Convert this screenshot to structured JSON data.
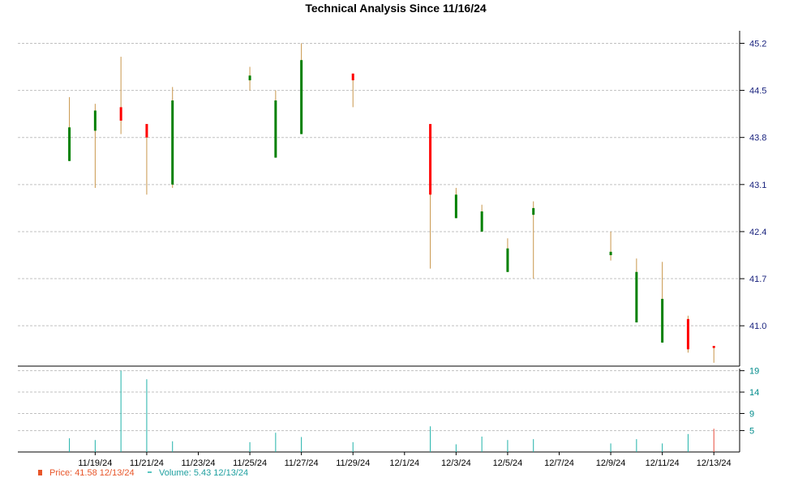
{
  "chart_data": {
    "type": "candlestick",
    "title": "Technical Analysis Since 11/16/24",
    "price_axis": {
      "ylim": [
        40.4,
        45.35
      ],
      "ticks": [
        "45.2",
        "44.5",
        "43.8",
        "43.1",
        "42.4",
        "41.7",
        "41.0"
      ]
    },
    "volume_axis": {
      "ylim": [
        0,
        19.5
      ],
      "ticks": [
        "19",
        "14",
        "9",
        "5"
      ]
    },
    "x_ticks": [
      "11/19/24",
      "11/21/24",
      "11/23/24",
      "11/25/24",
      "11/27/24",
      "11/29/24",
      "12/1/24",
      "12/3/24",
      "12/5/24",
      "12/7/24",
      "12/9/24",
      "12/11/24",
      "12/13/24"
    ],
    "grid": true,
    "colors": {
      "up": "#008000",
      "down": "#ff0000",
      "wick": "#c8964b",
      "volume": "#20b2aa",
      "last_volume": "#e74c3c",
      "price_axis": "#1a237e",
      "volume_axis": "#008b8b"
    },
    "candles": [
      {
        "date": "11/18/24",
        "open": 43.45,
        "high": 44.4,
        "low": 43.45,
        "close": 43.95,
        "volume": 3.2
      },
      {
        "date": "11/19/24",
        "open": 43.9,
        "high": 44.3,
        "low": 43.05,
        "close": 44.2,
        "volume": 2.8
      },
      {
        "date": "11/20/24",
        "open": 44.25,
        "high": 45.0,
        "low": 43.85,
        "close": 44.05,
        "volume": 19.0
      },
      {
        "date": "11/21/24",
        "open": 44.0,
        "high": 44.0,
        "low": 42.95,
        "close": 43.8,
        "volume": 17.0
      },
      {
        "date": "11/22/24",
        "open": 43.1,
        "high": 44.55,
        "low": 43.05,
        "close": 44.35,
        "volume": 2.5
      },
      {
        "date": "11/25/24",
        "open": 44.65,
        "high": 44.85,
        "low": 44.5,
        "close": 44.72,
        "volume": 2.3
      },
      {
        "date": "11/26/24",
        "open": 43.5,
        "high": 44.5,
        "low": 43.5,
        "close": 44.35,
        "volume": 4.5
      },
      {
        "date": "11/27/24",
        "open": 43.85,
        "high": 45.2,
        "low": 43.85,
        "close": 44.95,
        "volume": 3.5
      },
      {
        "date": "11/29/24",
        "open": 44.75,
        "high": 44.75,
        "low": 44.25,
        "close": 44.65,
        "volume": 2.3
      },
      {
        "date": "12/2/24",
        "open": 44.0,
        "high": 44.0,
        "low": 41.85,
        "close": 42.95,
        "volume": 6.0
      },
      {
        "date": "12/3/24",
        "open": 42.6,
        "high": 43.05,
        "low": 42.6,
        "close": 42.95,
        "volume": 1.8
      },
      {
        "date": "12/4/24",
        "open": 42.4,
        "high": 42.8,
        "low": 42.4,
        "close": 42.7,
        "volume": 3.6
      },
      {
        "date": "12/5/24",
        "open": 41.8,
        "high": 42.3,
        "low": 41.8,
        "close": 42.15,
        "volume": 2.8
      },
      {
        "date": "12/6/24",
        "open": 42.65,
        "high": 42.85,
        "low": 41.7,
        "close": 42.75,
        "volume": 3.0
      },
      {
        "date": "12/9/24",
        "open": 42.05,
        "high": 42.4,
        "low": 41.97,
        "close": 42.1,
        "volume": 2.0
      },
      {
        "date": "12/10/24",
        "open": 41.05,
        "high": 42.0,
        "low": 41.05,
        "close": 41.8,
        "volume": 3.0
      },
      {
        "date": "12/11/24",
        "open": 40.75,
        "high": 41.95,
        "low": 40.75,
        "close": 41.4,
        "volume": 2.0
      },
      {
        "date": "12/12/24",
        "open": 41.1,
        "high": 41.15,
        "low": 40.6,
        "close": 40.65,
        "volume": 4.2
      },
      {
        "date": "12/13/24",
        "open": 40.7,
        "high": 40.7,
        "low": 40.45,
        "close": 40.67,
        "volume": 5.43
      }
    ],
    "legend": [
      {
        "label": "Price:",
        "value": "41.58",
        "date": "12/13/24",
        "marker": "price"
      },
      {
        "label": "Volume:",
        "value": "5.43",
        "date": "12/13/24",
        "marker": "volume"
      }
    ]
  }
}
